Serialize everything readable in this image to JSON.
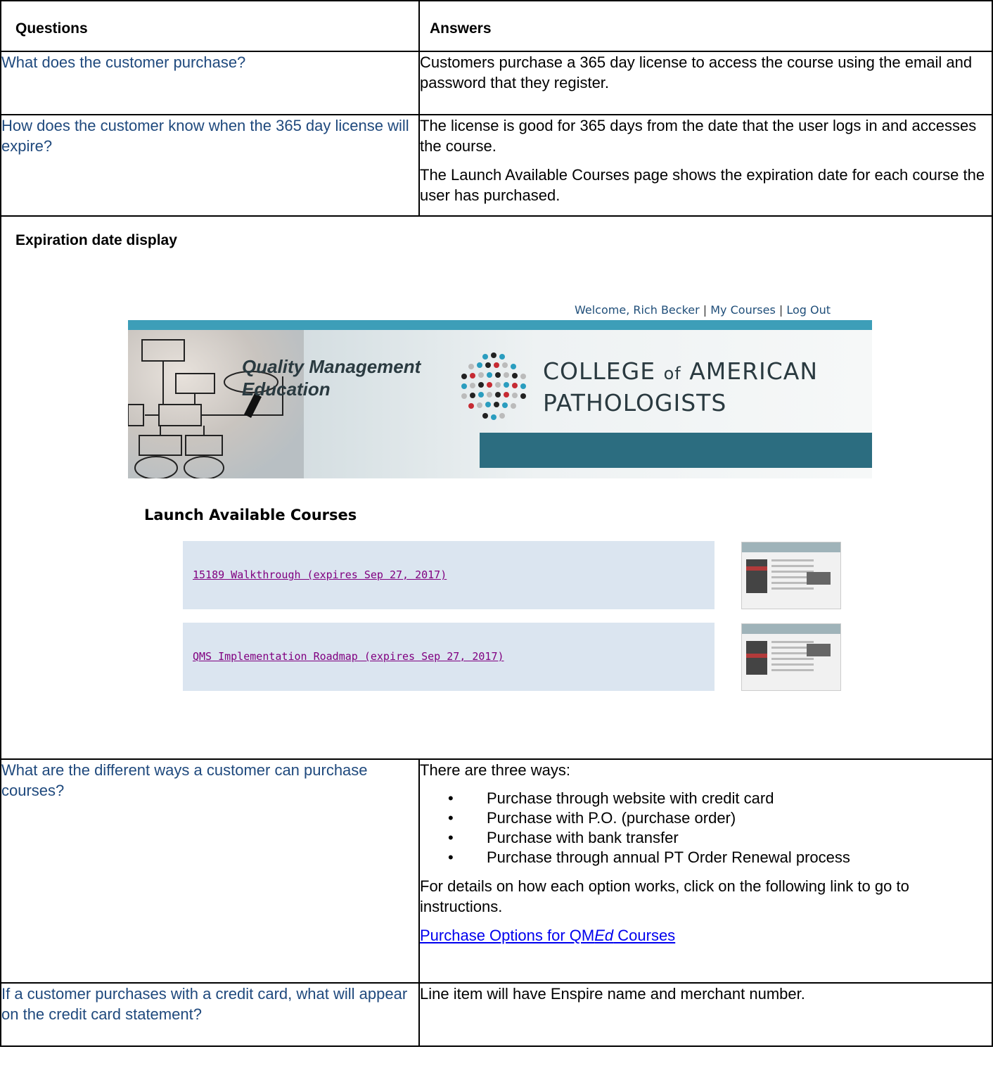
{
  "table": {
    "headers": {
      "questions": "Questions",
      "answers": "Answers"
    },
    "row1": {
      "question": "What does the customer purchase?",
      "answer": "Customers purchase a 365 day license to access the course using the email and password that they register."
    },
    "row2": {
      "question": "How does the customer know when the 365 day license will expire?",
      "answer_p1": "The license is good for 365 days from the date that the user logs in and accesses the course.",
      "answer_p2": "The Launch Available Courses page shows the expiration date for each course the user has purchased."
    },
    "expiration": {
      "title": "Expiration date display",
      "welcome": {
        "prefix": "Welcome, Rich Becker",
        "sep": " | ",
        "my_courses": "My Courses",
        "log_out": "Log Out"
      },
      "banner": {
        "qme_line1": "Quality Management",
        "qme_line2": "Education",
        "cap_line1a": "COLLEGE ",
        "cap_of": "of",
        "cap_line1b": " AMERICAN",
        "cap_line2": "PATHOLOGISTS"
      },
      "launch_title": "Launch Available Courses",
      "courses": [
        {
          "link": "15189 Walkthrough (expires Sep 27, 2017)"
        },
        {
          "link": "QMS Implementation Roadmap (expires Sep 27, 2017)"
        }
      ]
    },
    "row3": {
      "question": "What are the different ways a customer can purchase courses?",
      "intro": "There are three ways:",
      "bullets": [
        "Purchase through website with credit card",
        "Purchase with P.O. (purchase order)",
        "Purchase with bank transfer",
        "Purchase through annual PT Order Renewal process"
      ],
      "bullet_char": "•",
      "details": "For details on how each option works, click on the following link to go to instructions.",
      "link_pre": "Purchase Options for QM",
      "link_ital": "Ed",
      "link_post": " Courses"
    },
    "row4": {
      "question": "If a customer purchases with a credit card, what will appear on the credit card statement?",
      "answer": "Line item will have Enspire name and merchant number."
    }
  },
  "colors": {
    "question_text": "#1f497d",
    "link": "#0000ee",
    "course_bg": "#dbe5f0",
    "banner_teal": "#2c6d80"
  }
}
